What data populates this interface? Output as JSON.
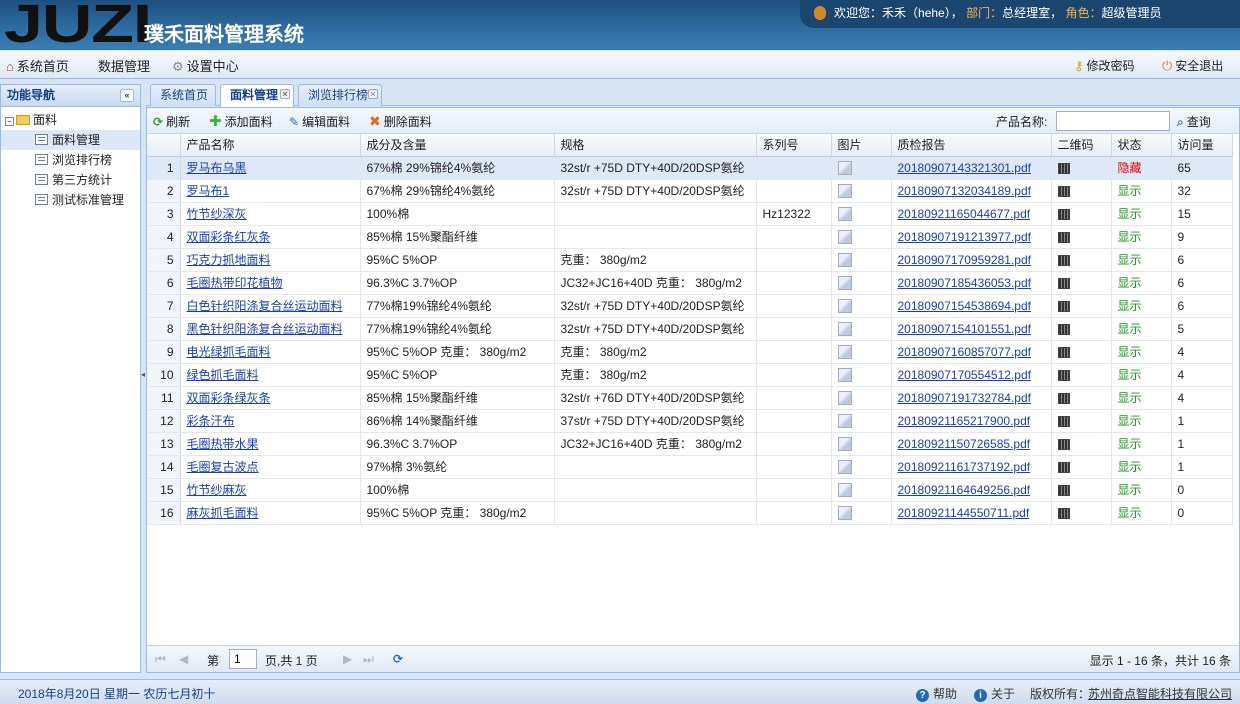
{
  "app": {
    "logo": "JUZI",
    "title": "璞禾面料管理系统"
  },
  "user": {
    "welcome_label": "欢迎您：",
    "welcome_value": "禾禾（hehe），",
    "dept_label": "部门：",
    "dept_value": "总经理室，",
    "role_label": "角色：",
    "role_value": "超级管理员"
  },
  "menu": {
    "home": "系统首页",
    "data": "数据管理",
    "settings": "设置中心",
    "change_pwd": "修改密码",
    "logout": "安全退出"
  },
  "sidebar": {
    "title": "功能导航",
    "root": "面料",
    "items": [
      "面料管理",
      "浏览排行榜",
      "第三方统计",
      "测试标准管理"
    ]
  },
  "tabs": [
    "系统首页",
    "面料管理",
    "浏览排行榜"
  ],
  "toolbar": {
    "refresh": "刷新",
    "add": "添加面料",
    "edit": "编辑面料",
    "delete": "删除面料",
    "search_label": "产品名称:",
    "search_button": "查询"
  },
  "table": {
    "columns": [
      "产品名称",
      "成分及含量",
      "规格",
      "系列号",
      "图片",
      "质检报告",
      "二维码",
      "状态",
      "访问量"
    ],
    "rows": [
      {
        "n": "1",
        "name": "罗马布乌黑",
        "comp": "67%棉 29%锦纶4%氨纶",
        "spec": "32st/r +75D DTY+40D/20DSP氨纶",
        "series": "",
        "report": "20180907143321301.pdf",
        "status": "隐藏",
        "views": "65"
      },
      {
        "n": "2",
        "name": "罗马布1",
        "comp": "67%棉 29%锦纶4%氨纶",
        "spec": "32st/r +75D DTY+40D/20DSP氨纶",
        "series": "",
        "report": "20180907132034189.pdf",
        "status": "显示",
        "views": "32"
      },
      {
        "n": "3",
        "name": "竹节纱深灰",
        "comp": "100%棉",
        "spec": "",
        "series": "Hz12322",
        "report": "20180921165044677.pdf",
        "status": "显示",
        "views": "15"
      },
      {
        "n": "4",
        "name": "双面彩条红灰条",
        "comp": "85%棉 15%聚酯纤维",
        "spec": "",
        "series": "",
        "report": "20180907191213977.pdf",
        "status": "显示",
        "views": "9"
      },
      {
        "n": "5",
        "name": "巧克力抓地面料",
        "comp": "95%C 5%OP",
        "spec": "克重： 380g/m2",
        "series": "",
        "report": "20180907170959281.pdf",
        "status": "显示",
        "views": "6"
      },
      {
        "n": "6",
        "name": "毛圈热带印花植物",
        "comp": "96.3%C 3.7%OP",
        "spec": "JC32+JC16+40D 克重： 380g/m2",
        "series": "",
        "report": "20180907185436053.pdf",
        "status": "显示",
        "views": "6"
      },
      {
        "n": "7",
        "name": "白色针织阳涤复合丝运动面料",
        "comp": "77%棉19%锦纶4%氨纶",
        "spec": "32st/r +75D DTY+40D/20DSP氨纶",
        "series": "",
        "report": "20180907154538694.pdf",
        "status": "显示",
        "views": "6"
      },
      {
        "n": "8",
        "name": "黑色针织阳涤复合丝运动面料",
        "comp": "77%棉19%锦纶4%氨纶",
        "spec": "32st/r +75D DTY+40D/20DSP氨纶",
        "series": "",
        "report": "20180907154101551.pdf",
        "status": "显示",
        "views": "5"
      },
      {
        "n": "9",
        "name": "电光绿抓毛面料",
        "comp": "95%C 5%OP 克重： 380g/m2",
        "spec": "克重： 380g/m2",
        "series": "",
        "report": "20180907160857077.pdf",
        "status": "显示",
        "views": "4"
      },
      {
        "n": "10",
        "name": "绿色抓毛面料",
        "comp": "95%C 5%OP",
        "spec": "克重： 380g/m2",
        "series": "",
        "report": "20180907170554512.pdf",
        "status": "显示",
        "views": "4"
      },
      {
        "n": "11",
        "name": "双面彩条绿灰条",
        "comp": "85%棉 15%聚酯纤维",
        "spec": "32st/r +76D DTY+40D/20DSP氨纶",
        "series": "",
        "report": "20180907191732784.pdf",
        "status": "显示",
        "views": "4"
      },
      {
        "n": "12",
        "name": "彩条汗布",
        "comp": "86%棉 14%聚酯纤维",
        "spec": "37st/r +75D DTY+40D/20DSP氨纶",
        "series": "",
        "report": "20180921165217900.pdf",
        "status": "显示",
        "views": "1"
      },
      {
        "n": "13",
        "name": "毛圈热带水果",
        "comp": "96.3%C 3.7%OP",
        "spec": "JC32+JC16+40D 克重： 380g/m2",
        "series": "",
        "report": "20180921150726585.pdf",
        "status": "显示",
        "views": "1"
      },
      {
        "n": "14",
        "name": "毛圈复古波点",
        "comp": "97%棉 3%氨纶",
        "spec": "",
        "series": "",
        "report": "20180921161737192.pdf",
        "status": "显示",
        "views": "1"
      },
      {
        "n": "15",
        "name": "竹节纱麻灰",
        "comp": "100%棉",
        "spec": "",
        "series": "",
        "report": "20180921164649256.pdf",
        "status": "显示",
        "views": "0"
      },
      {
        "n": "16",
        "name": "麻灰抓毛面料",
        "comp": "95%C 5%OP 克重： 380g/m2",
        "spec": "",
        "series": "",
        "report": "20180921144550711.pdf",
        "status": "显示",
        "views": "0"
      }
    ]
  },
  "pager": {
    "page_prefix": "第",
    "page_value": "1",
    "page_suffix": "页,共 1 页",
    "summary": "显示 1 - 16 条，共计 16 条"
  },
  "footer": {
    "date": "2018年8月20日 星期一 农历七月初十",
    "help": "帮助",
    "about": "关于",
    "copyright": "版权所有：",
    "company": "苏州奇点智能科技有限公司"
  },
  "colors": {
    "header": "#2f6da2",
    "link": "#1a3fb5",
    "status_show": "#1c9a1c",
    "status_hide": "#ee0000"
  }
}
